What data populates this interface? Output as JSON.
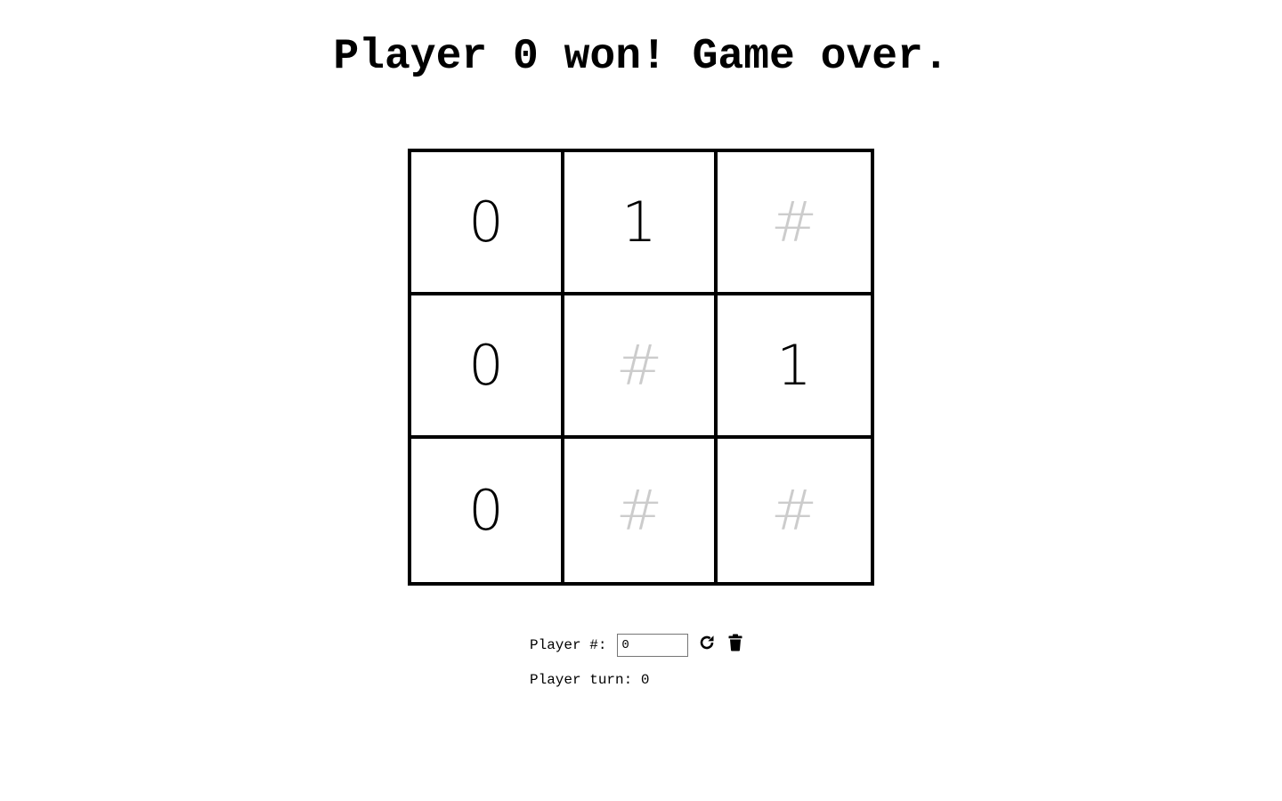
{
  "header": {
    "status_message": "Player 0 won! Game over."
  },
  "board": {
    "cells": [
      "0",
      "1",
      "#",
      "0",
      "#",
      "1",
      "0",
      "#",
      "#"
    ],
    "empty_marker": "#"
  },
  "controls": {
    "player_label": "Player #:",
    "player_value": "0",
    "refresh_icon": "refresh-icon",
    "trash_icon": "trash-icon"
  },
  "status": {
    "turn_label": "Player turn:",
    "turn_value": "0"
  },
  "colors": {
    "text": "#000000",
    "empty_cell": "#cccccc",
    "border": "#000000"
  }
}
